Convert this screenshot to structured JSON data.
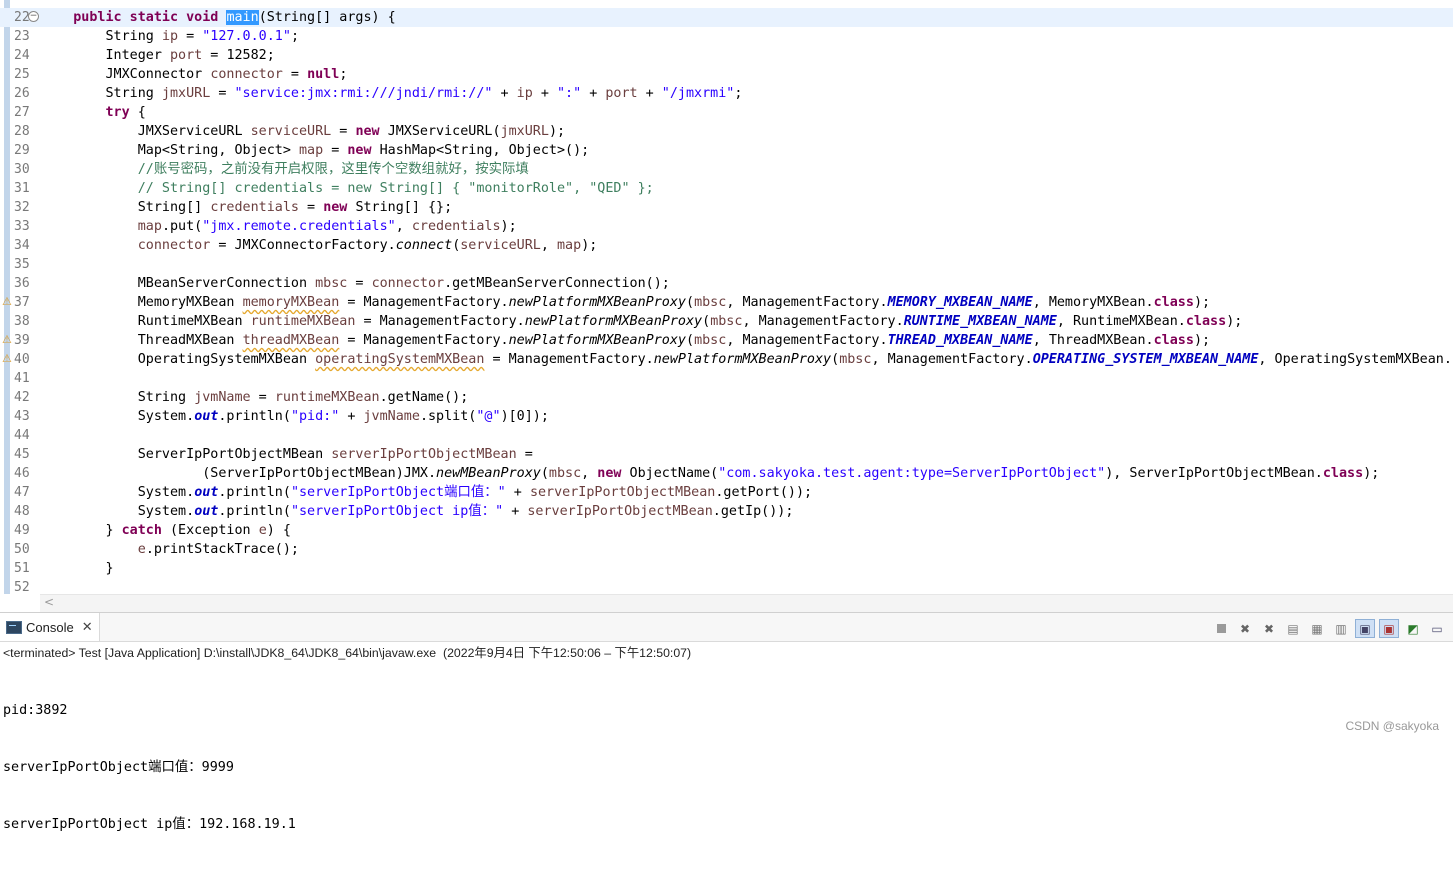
{
  "editor": {
    "top_line_number": "21",
    "lines": [
      {
        "num": "22",
        "current": true,
        "fold": "−"
      },
      {
        "num": "23"
      },
      {
        "num": "24"
      },
      {
        "num": "25"
      },
      {
        "num": "26"
      },
      {
        "num": "27"
      },
      {
        "num": "28"
      },
      {
        "num": "29"
      },
      {
        "num": "30"
      },
      {
        "num": "31"
      },
      {
        "num": "32"
      },
      {
        "num": "33"
      },
      {
        "num": "34"
      },
      {
        "num": "35"
      },
      {
        "num": "36"
      },
      {
        "num": "37",
        "warning": true
      },
      {
        "num": "38"
      },
      {
        "num": "39",
        "warning": true
      },
      {
        "num": "40",
        "warning": true
      },
      {
        "num": "41"
      },
      {
        "num": "42"
      },
      {
        "num": "43"
      },
      {
        "num": "44"
      },
      {
        "num": "45"
      },
      {
        "num": "46"
      },
      {
        "num": "47"
      },
      {
        "num": "48"
      },
      {
        "num": "49"
      },
      {
        "num": "50"
      },
      {
        "num": "51"
      },
      {
        "num": "52"
      }
    ],
    "code": {
      "l22_pre": "    public static void ",
      "l22_sel": "main",
      "l22_post": "(String[] args) {",
      "t_string": "String",
      "t_integer": "Integer",
      "t_connector": "JMXConnector",
      "v_ip": "ip",
      "v_port": "port",
      "v_connector": "connector",
      "v_jmxurl": "jmxURL",
      "s_ip": "\"127.0.0.1\"",
      "n_port": "12582",
      "k_null": "null",
      "s_svc": "\"service:jmx:rmi:///jndi/rmi://\"",
      "s_colon": "\":\"",
      "s_jmxrmi": "\"/jmxrmi\"",
      "k_try": "try",
      "l28_a": "JMXServiceURL",
      "v_serviceurl": "serviceURL",
      "k_new": "new",
      "l28_b": "JMXServiceURL(",
      "l29_a": "Map<String, Object>",
      "v_map": "map",
      "l29_b": "HashMap<String, Object>();",
      "c30": "//账号密码，之前没有开启权限，这里传个空数组就好，按实际填",
      "c31": "// String[] credentials = new String[] { \"monitorRole\", \"QED\" };",
      "l32_a": "String[]",
      "v_credentials": "credentials",
      "l32_b": "String[] {};",
      "l33_a": ".put(",
      "s_cred": "\"jmx.remote.credentials\"",
      "l34_a": "JMXConnectorFactory.",
      "m_connect": "connect",
      "l36_a": "MBeanServerConnection",
      "v_mbsc": "mbsc",
      "l36_b": ".getMBeanServerConnection();",
      "l37_t": "MemoryMXBean",
      "v_memory": "memoryMXBean",
      "mf": "ManagementFactory.",
      "m_proxy": "newPlatformMXBeanProxy",
      "f_memory": "MEMORY_MXBEAN_NAME",
      "l37_c": "MemoryMXBean.",
      "k_class": "class",
      "l38_t": "RuntimeMXBean",
      "v_runtime": "runtimeMXBean",
      "f_runtime": "RUNTIME_MXBEAN_NAME",
      "l38_c": "RuntimeMXBean.",
      "l39_t": "ThreadMXBean",
      "v_thread": "threadMXBean",
      "f_thread": "THREAD_MXBEAN_NAME",
      "l39_c": "ThreadMXBean.",
      "l40_t": "OperatingSystemMXBean",
      "v_os": "operatingSystemMXBean",
      "f_os": "OPERATING_SYSTEM_MXBEAN_NAME",
      "l40_c": "OperatingSystemMXBean.cl",
      "v_jvmname": "jvmName",
      "l42_b": ".getName();",
      "l43_a": "System.",
      "f_out": "out",
      "l43_b": ".println(",
      "s_pid": "\"pid:\"",
      "l43_c": ".split(",
      "s_at": "\"@\"",
      "l43_d": ")[0]);",
      "l45_a": "ServerIpPortObjectMBean",
      "v_sipo": "serverIpPortObjectMBean",
      "l46_a": "(ServerIpPortObjectMBean)JMX.",
      "m_newmbean": "newMBeanProxy",
      "l46_b": "ObjectName(",
      "s_objname": "\"com.sakyoka.test.agent:type=ServerIpPortObject\"",
      "l46_c": "), ServerIpPortObjectMBean.",
      "s_port": "\"serverIpPortObject端口值：\"",
      "l47_b": ".getPort());",
      "s_ipv": "\"serverIpPortObject ip值：\"",
      "l48_b": ".getIp());",
      "k_catch": "catch",
      "l49_b": "(Exception ",
      "v_e": "e",
      "l50_b": ".printStackTrace();"
    }
  },
  "console": {
    "tab_label": "Console",
    "status": "<terminated> Test [Java Application] D:\\install\\JDK8_64\\JDK8_64\\bin\\javaw.exe  (2022年9月4日 下午12:50:06 – 下午12:50:07)",
    "output": [
      "pid:3892",
      "serverIpPortObject端口值：9999",
      "serverIpPortObject ip值：192.168.19.1"
    ]
  },
  "watermark": "CSDN @sakyoka"
}
